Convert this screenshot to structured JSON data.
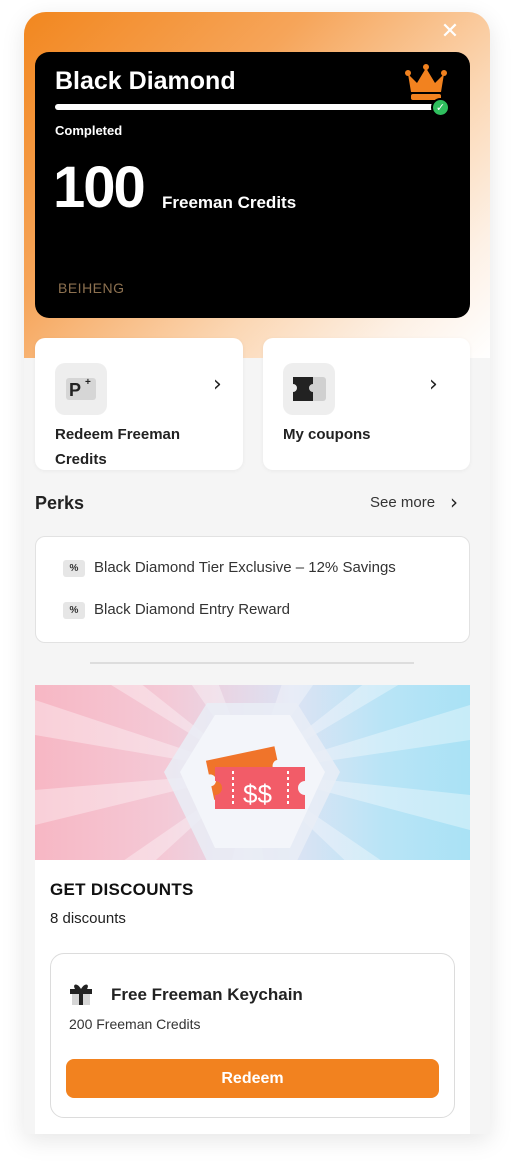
{
  "colors": {
    "accent": "#f2821f",
    "card_bg": "#000000",
    "success": "#2fbf5e"
  },
  "header": {
    "close_icon": "close-icon"
  },
  "tier": {
    "name": "Black Diamond",
    "progress": 1.0,
    "status": "Completed",
    "credits": "100",
    "credits_unit": "Freeman Credits",
    "brand": "BEIHENG"
  },
  "actions": [
    {
      "label": "Redeem Freeman Credits",
      "icon": "points-icon"
    },
    {
      "label": "My coupons",
      "icon": "coupon-icon"
    }
  ],
  "perks": {
    "title": "Perks",
    "see_more": "See more",
    "items": [
      {
        "label": "Black Diamond Tier Exclusive – 12% Savings",
        "icon_text": "%"
      },
      {
        "label": "Black Diamond Entry Reward",
        "icon_text": "%"
      }
    ]
  },
  "discounts": {
    "title": "GET DISCOUNTS",
    "count": "8 discounts",
    "banner_text": "$$",
    "reward": {
      "name": "Free Freeman Keychain",
      "cost": "200 Freeman Credits",
      "button": "Redeem"
    }
  }
}
